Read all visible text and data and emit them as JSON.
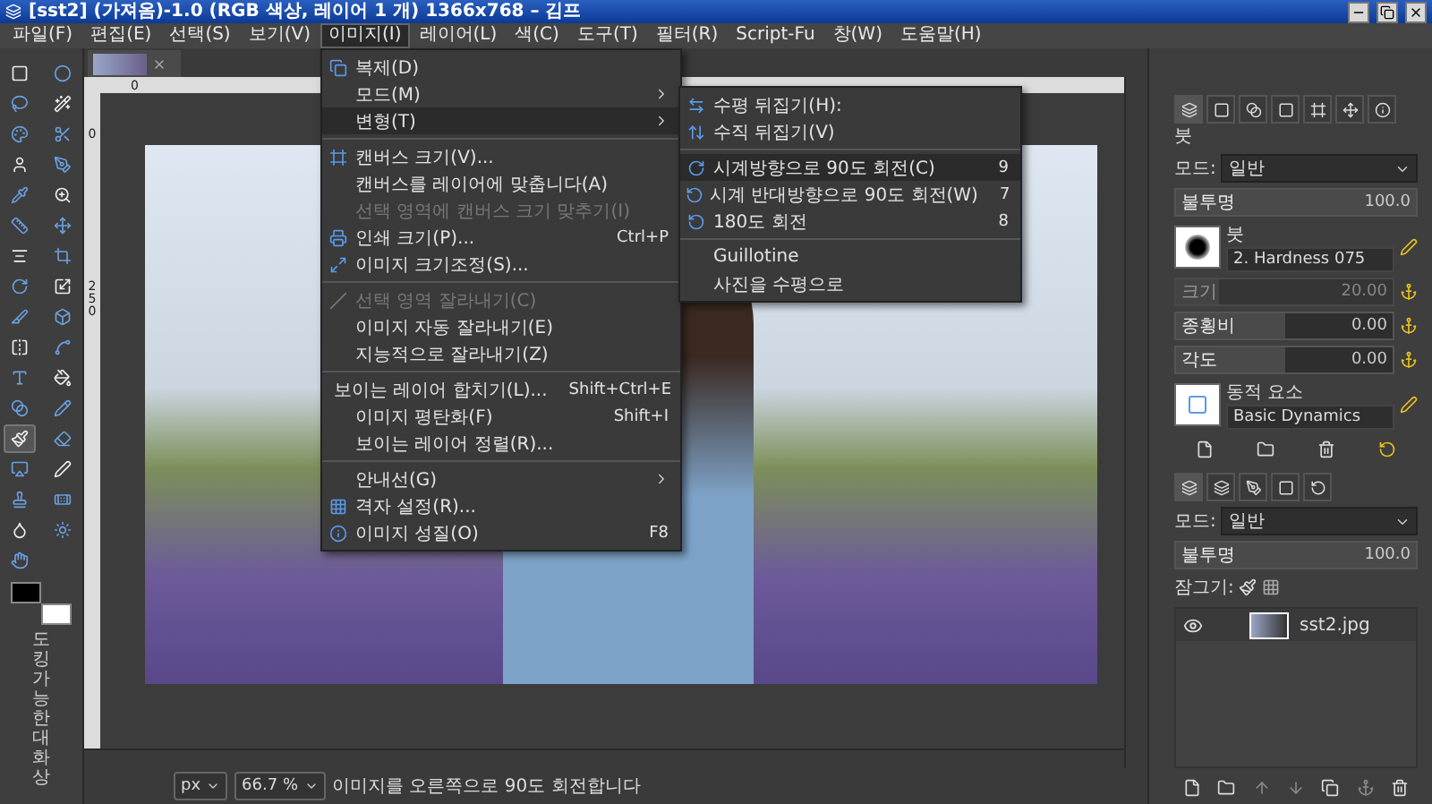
{
  "window": {
    "title": "[sst2] (가져옴)-1.0 (RGB 색상, 레이어 1 개) 1366x768 – 김프"
  },
  "menu_bar": [
    {
      "label": "파일(F)",
      "selected": false
    },
    {
      "label": "편집(E)",
      "selected": false
    },
    {
      "label": "선택(S)",
      "selected": false
    },
    {
      "label": "보기(V)",
      "selected": false
    },
    {
      "label": "이미지(I)",
      "selected": true
    },
    {
      "label": "레이어(L)",
      "selected": false
    },
    {
      "label": "색(C)",
      "selected": false
    },
    {
      "label": "도구(T)",
      "selected": false
    },
    {
      "label": "필터(R)",
      "selected": false
    },
    {
      "label": "Script-Fu",
      "selected": false
    },
    {
      "label": "창(W)",
      "selected": false
    },
    {
      "label": "도움말(H)",
      "selected": false
    }
  ],
  "image_menu": [
    {
      "kind": "item",
      "label": "복제(D)",
      "submenu": false,
      "disabled": false,
      "selected": false
    },
    {
      "kind": "item",
      "label": "모드(M)",
      "submenu": true,
      "disabled": false,
      "selected": false
    },
    {
      "kind": "item",
      "label": "변형(T)",
      "submenu": true,
      "disabled": false,
      "selected": true
    },
    {
      "kind": "separator"
    },
    {
      "kind": "item",
      "label": "캔버스 크기(V)...",
      "submenu": false,
      "disabled": false,
      "selected": false
    },
    {
      "kind": "item",
      "label": "캔버스를 레이어에 맞춥니다(A)",
      "submenu": false,
      "disabled": false,
      "selected": false
    },
    {
      "kind": "item",
      "label": "선택 영역에 캔버스 크기 맞추기(I)",
      "submenu": false,
      "disabled": true,
      "selected": false
    },
    {
      "kind": "item",
      "label": "인쇄 크기(P)...",
      "shortcut": "Ctrl+P",
      "submenu": false,
      "disabled": false,
      "selected": false
    },
    {
      "kind": "item",
      "label": "이미지 크기조정(S)...",
      "submenu": false,
      "disabled": false,
      "selected": false
    },
    {
      "kind": "separator"
    },
    {
      "kind": "item",
      "label": "선택 영역 잘라내기(C)",
      "submenu": false,
      "disabled": true,
      "selected": false
    },
    {
      "kind": "item",
      "label": "이미지 자동 잘라내기(E)",
      "submenu": false,
      "disabled": false,
      "selected": false
    },
    {
      "kind": "item",
      "label": "지능적으로 잘라내기(Z)",
      "submenu": false,
      "disabled": false,
      "selected": false
    },
    {
      "kind": "separator"
    },
    {
      "kind": "item",
      "label": "보이는 레이어 합치기(L)...",
      "shortcut": "Shift+Ctrl+E",
      "submenu": false,
      "disabled": false,
      "selected": false
    },
    {
      "kind": "item",
      "label": "이미지 평탄화(F)",
      "shortcut": "Shift+I",
      "submenu": false,
      "disabled": false,
      "selected": false
    },
    {
      "kind": "item",
      "label": "보이는 레이어 정렬(R)...",
      "submenu": false,
      "disabled": false,
      "selected": false
    },
    {
      "kind": "separator"
    },
    {
      "kind": "item",
      "label": "안내선(G)",
      "submenu": true,
      "disabled": false,
      "selected": false
    },
    {
      "kind": "item",
      "label": "격자 설정(R)...",
      "submenu": false,
      "disabled": false,
      "selected": false
    },
    {
      "kind": "item",
      "label": "이미지 성질(O)",
      "shortcut": "F8",
      "submenu": false,
      "disabled": false,
      "selected": false
    }
  ],
  "transform_menu": [
    {
      "kind": "item",
      "label": "수평 뒤집기(H):",
      "selected": false
    },
    {
      "kind": "item",
      "label": "수직 뒤집기(V)",
      "selected": false
    },
    {
      "kind": "separator"
    },
    {
      "kind": "item",
      "label": "시계방향으로 90도 회전(C)",
      "shortcut": "9",
      "selected": true
    },
    {
      "kind": "item",
      "label": "시계 반대방향으로 90도 회전(W)",
      "shortcut": "7",
      "selected": false
    },
    {
      "kind": "item",
      "label": "180도 회전",
      "shortcut": "8",
      "selected": false
    },
    {
      "kind": "separator"
    },
    {
      "kind": "item",
      "label": "Guillotine",
      "selected": false
    },
    {
      "kind": "item",
      "label": "사진을 수평으로",
      "selected": false
    }
  ],
  "toolbox": {
    "tools": [
      {
        "selected": false
      },
      {
        "selected": false
      },
      {
        "selected": false
      },
      {
        "selected": false
      },
      {
        "selected": false
      },
      {
        "selected": false
      },
      {
        "selected": false
      },
      {
        "selected": false
      },
      {
        "selected": false
      },
      {
        "selected": false
      },
      {
        "selected": false
      },
      {
        "selected": false
      },
      {
        "selected": false
      },
      {
        "selected": false
      },
      {
        "selected": false
      },
      {
        "selected": false
      },
      {
        "selected": false
      },
      {
        "selected": false
      },
      {
        "selected": false
      },
      {
        "selected": false
      },
      {
        "selected": false
      },
      {
        "selected": false
      },
      {
        "selected": false
      },
      {
        "selected": false
      },
      {
        "selected": true
      },
      {
        "selected": false
      },
      {
        "selected": false
      },
      {
        "selected": false
      },
      {
        "selected": false
      },
      {
        "selected": false
      },
      {
        "selected": false
      },
      {
        "selected": false
      },
      {
        "selected": false
      }
    ],
    "hint": "도킹가능한대화상"
  },
  "canvas": {
    "top_ruler": [
      "0"
    ],
    "left_ruler": [
      "0",
      "250"
    ]
  },
  "status_bar": {
    "unit": "px",
    "zoom": "66.7 %",
    "message": "이미지를 오른쪽으로 90도 회전합니다"
  },
  "brush_dock": {
    "title": "붓",
    "mode_label": "모드:",
    "mode": "일반",
    "opacity": {
      "label": "불투명",
      "value": "100.0",
      "level": 1
    },
    "brush_label": "붓",
    "brush": "2. Hardness 075",
    "sliders": [
      {
        "label": "크기",
        "value": "20.00",
        "level": 0.2,
        "disabled": true
      },
      {
        "label": "종횡비",
        "value": "0.00",
        "level": 0.5,
        "disabled": false
      },
      {
        "label": "각도",
        "value": "0.00",
        "level": 0.5,
        "disabled": false
      }
    ],
    "dynamics_label": "동적 요소",
    "dynamics": "Basic Dynamics"
  },
  "layers_dock": {
    "mode_label": "모드:",
    "mode": "일반",
    "opacity": {
      "label": "불투명",
      "value": "100.0",
      "level": 1
    },
    "lock_label": "잠그기:",
    "layers": [
      {
        "name": "sst2.jpg",
        "visible": true,
        "selected": false
      }
    ]
  }
}
